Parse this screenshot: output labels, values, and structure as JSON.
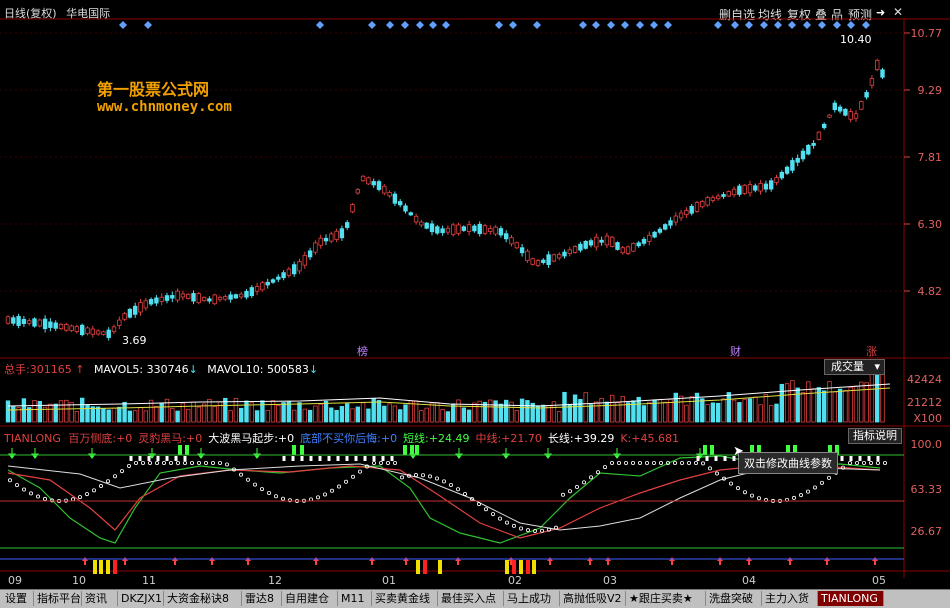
{
  "header": {
    "title": "日线(复权)",
    "stock_name": "华电国际",
    "buttons": [
      "删自选",
      "均线",
      "复权",
      "叠",
      "品",
      "预测"
    ],
    "close_label": "✕"
  },
  "watermark": {
    "site_name": "第一股票公式网",
    "url": "www.chnmoney.com"
  },
  "price_axis": [
    "10.77",
    "9.29",
    "7.81",
    "6.30",
    "4.82"
  ],
  "price_marks": {
    "high": "10.40",
    "low": "3.69",
    "events": [
      "榜",
      "财",
      "涨"
    ]
  },
  "volume_panel": {
    "total_label": "总手:",
    "total_value": "301165",
    "mavol5_label": "MAVOL5:",
    "mavol5_value": "330746",
    "mavol10_label": "MAVOL10:",
    "mavol10_value": "500583",
    "selector_value": "成交量",
    "axis": [
      "42424",
      "21212",
      "X100"
    ]
  },
  "indicator_panel": {
    "name": "TIANLONG",
    "items": [
      {
        "label": "百万侧底:",
        "value": "+0",
        "color": "#e04040"
      },
      {
        "label": "灵豹黑马:",
        "value": "+0",
        "color": "#e04040"
      },
      {
        "label": "大波黑马起步:",
        "value": "+0",
        "color": "#ffffff"
      },
      {
        "label": "底部不买你后悔:",
        "value": "+0",
        "color": "#4080ff"
      },
      {
        "label": "短线:",
        "value": "+24.49",
        "color": "#40ff40"
      },
      {
        "label": "中线:",
        "value": "+21.70",
        "color": "#e04040"
      },
      {
        "label": "长线:",
        "value": "+39.29",
        "color": "#ffffff"
      },
      {
        "label": "K:",
        "value": "+45.681",
        "color": "#e04040"
      }
    ],
    "help_button": "指标说明",
    "axis": [
      "100.0",
      "63.33",
      "26.67"
    ],
    "tooltip": "双击修改曲线参数"
  },
  "dates": [
    "09",
    "10",
    "11",
    "12",
    "01",
    "02",
    "03",
    "04",
    "05"
  ],
  "tabs": [
    "设置",
    "指标平台",
    "资讯",
    "DKZJX1",
    "大资金秘诀8",
    "雷达8",
    "自用建仓",
    "M11",
    "买卖黄金线",
    "最佳买入点",
    "马上成功",
    "高抛低吸V2",
    "★跟庄买卖★",
    "洗盘突破",
    "主力入货",
    "TIANLONG"
  ],
  "colors": {
    "up": "#e04040",
    "down": "#50e0f0",
    "grid": "#8a0000",
    "accent": "#f0a000"
  }
}
